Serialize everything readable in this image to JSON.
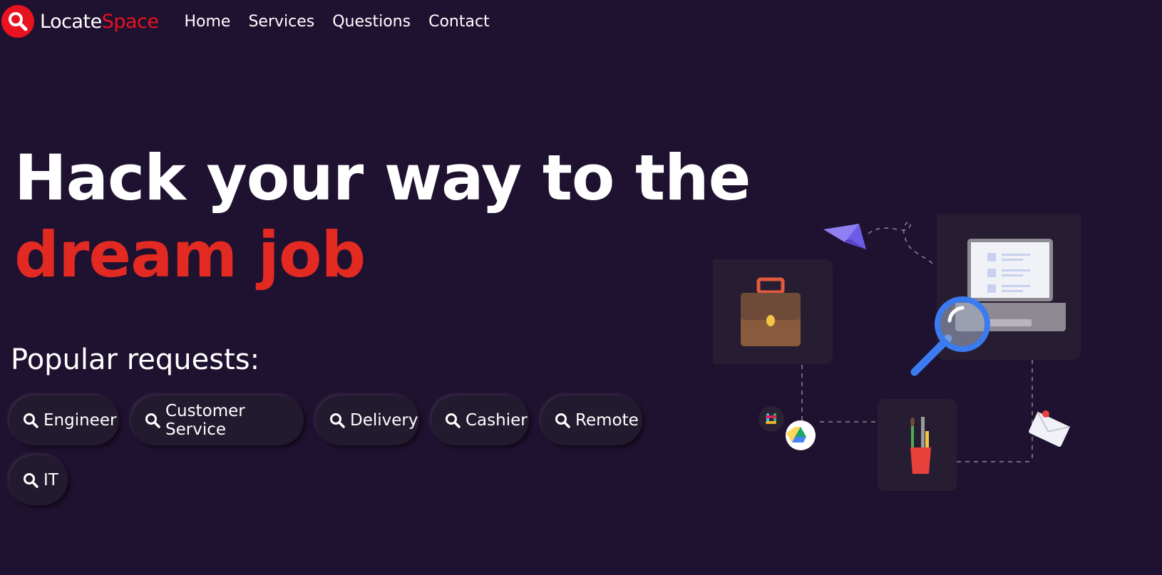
{
  "brand": {
    "name_part1": "Locate",
    "name_part2": "Space",
    "accent_color": "#e8131f"
  },
  "nav": {
    "items": [
      {
        "label": "Home"
      },
      {
        "label": "Services"
      },
      {
        "label": "Questions"
      },
      {
        "label": "Contact"
      }
    ]
  },
  "hero": {
    "line1": "Hack your way to the",
    "line2": "dream job",
    "line2_color": "#e22a22"
  },
  "popular": {
    "heading": "Popular requests:",
    "chips": [
      {
        "label": "Engineer",
        "icon": "search-icon"
      },
      {
        "label": "Customer Service",
        "icon": "search-icon"
      },
      {
        "label": "Delivery",
        "icon": "search-icon"
      },
      {
        "label": "Cashier",
        "icon": "search-icon"
      },
      {
        "label": "Remote",
        "icon": "search-icon"
      },
      {
        "label": "IT",
        "icon": "search-icon"
      }
    ]
  },
  "illustration": {
    "icons": [
      "paper-plane-icon",
      "briefcase-icon",
      "laptop-icon",
      "magnifier-icon",
      "pencil-cup-icon",
      "envelope-icon",
      "slack-icon",
      "google-drive-icon"
    ]
  },
  "colors": {
    "background": "#1f1130",
    "card": "#271d33",
    "chip": "#221a2e"
  }
}
